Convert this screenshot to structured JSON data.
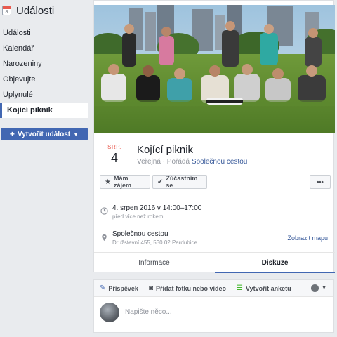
{
  "sidebar": {
    "title": "Události",
    "calendar_icon_num": "8",
    "items": [
      {
        "label": "Události",
        "active": false
      },
      {
        "label": "Kalendář",
        "active": false
      },
      {
        "label": "Narozeniny",
        "active": false
      },
      {
        "label": "Objevujte",
        "active": false
      },
      {
        "label": "Uplynulé",
        "active": false
      },
      {
        "label": "Kojící piknik",
        "active": true
      }
    ],
    "create_button": "Vytvořit událost"
  },
  "event": {
    "month": "SRP.",
    "day": "4",
    "title": "Kojící piknik",
    "visibility": "Veřejná",
    "host_prefix": "· Pořádá",
    "host": "Společnou cestou",
    "buttons": {
      "interested": "Mám zájem",
      "going": "Zúčastním se",
      "more": "•••"
    },
    "datetime": "4. srpen 2016 v 14:00–17:00",
    "datetime_sub": "před více než rokem",
    "location": "Společnou cestou",
    "address": "Družstevní 455, 530 02 Pardubice",
    "map_link": "Zobrazit mapu"
  },
  "tabs": [
    {
      "label": "Informace",
      "active": false
    },
    {
      "label": "Diskuze",
      "active": true
    }
  ],
  "composer": {
    "post": "Příspěvek",
    "photo": "Přidat fotku nebo video",
    "poll": "Vytvořit anketu",
    "placeholder": "Napište něco..."
  },
  "colors": {
    "accent": "#4267b2",
    "link": "#365899",
    "month_red": "#e85a4f"
  }
}
